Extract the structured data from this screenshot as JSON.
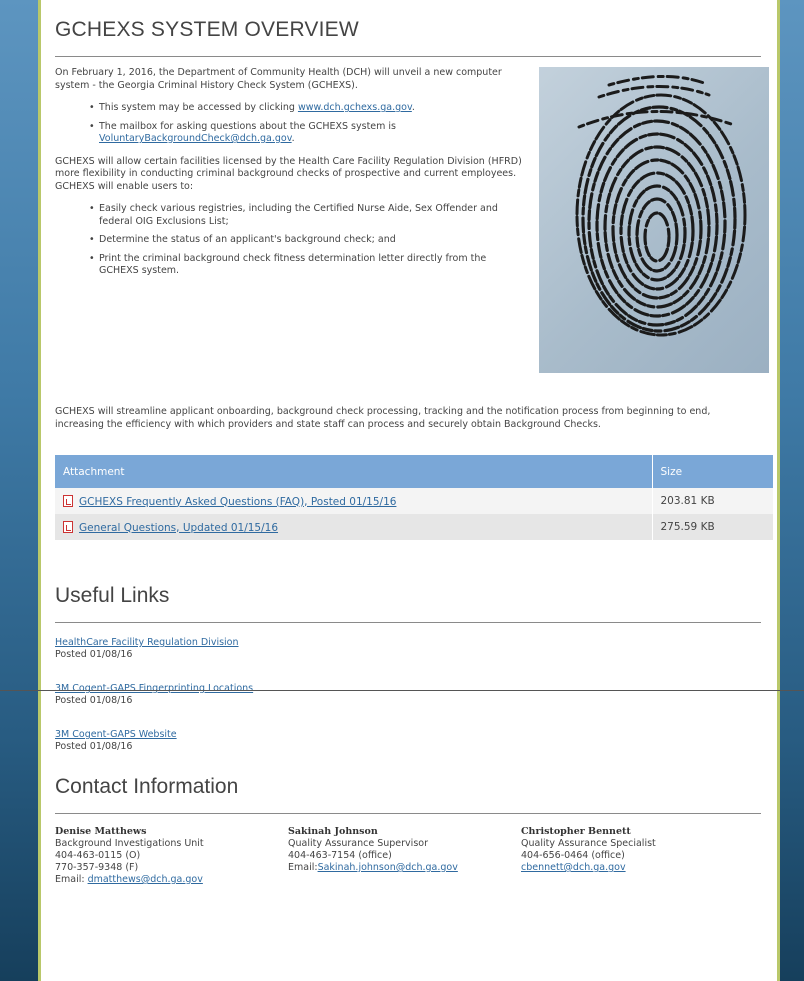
{
  "overview": {
    "title": "GCHEXS SYSTEM OVERVIEW",
    "intro": "On February 1, 2016, the Department of Community Health (DCH) will unveil a new computer system - the Georgia Criminal History Check System (GCHEXS).",
    "bullet1_text": "This system may be accessed by clicking ",
    "bullet1_link": "www.dch.gchexs.ga.gov",
    "bullet1_end": ".",
    "bullet2_text": "The mailbox for asking questions about the GCHEXS system is ",
    "bullet2_link": "VoluntaryBackgroundCheck@dch.ga.gov",
    "bullet2_end": ".",
    "allow_text": "GCHEXS will allow certain facilities licensed by the Health Care Facility Regulation Division (HFRD) more flexibility in conducting criminal background checks of prospective and current employees. GCHEXS will enable users to:",
    "features": [
      "Easily check various registries, including the Certified Nurse Aide, Sex Offender and federal OIG Exclusions List;",
      "Determine the status of an applicant's background check; and",
      "Print the criminal background check fitness determination letter directly from the GCHEXS system."
    ],
    "image_icon": "fingerprint-image",
    "streamline": "GCHEXS will streamline applicant onboarding, background check processing, tracking and the notification process from beginning to end, increasing the efficiency with which providers and state staff can process and securely obtain Background Checks."
  },
  "attachments": {
    "header_attachment": "Attachment",
    "header_size": "Size",
    "rows": [
      {
        "name": "GCHEXS Frequently Asked Questions (FAQ), Posted 01/15/16",
        "size": "203.81 KB"
      },
      {
        "name": "General Questions, Updated 01/15/16",
        "size": "275.59 KB"
      }
    ]
  },
  "useful_links": {
    "title": "Useful Links",
    "items": [
      {
        "label": "HealthCare Facility Regulation Division",
        "posted": "Posted 01/08/16"
      },
      {
        "label": "3M Cogent-GAPS Fingerprinting Locations",
        "posted": "Posted 01/08/16"
      },
      {
        "label": "3M Cogent-GAPS Website",
        "posted": "Posted 01/08/16"
      }
    ]
  },
  "contact": {
    "title": "Contact Information",
    "people": [
      {
        "name": "Denise Matthews",
        "role": "Background Investigations Unit",
        "phone1": "404-463-0115 (O)",
        "phone2": "770-357-9348 (F)",
        "email_label": "Email: ",
        "email": "dmatthews@dch.ga.gov"
      },
      {
        "name": "Sakinah Johnson",
        "role": "Quality Assurance Supervisor",
        "phone1": "404-463-7154 (office)",
        "email_label": "Email:",
        "email": "Sakinah.johnson@dch.ga.gov"
      },
      {
        "name": "Christopher Bennett",
        "role": "Quality Assurance Specialist",
        "phone1": "404-656-0464 (office)",
        "email": "cbennett@dch.ga.gov"
      }
    ]
  },
  "colors": {
    "table_header": "#7aa7d7",
    "link": "#2f6aa0",
    "frame_accent": "#b9c86a",
    "background_blue": "#3f7aa6"
  }
}
